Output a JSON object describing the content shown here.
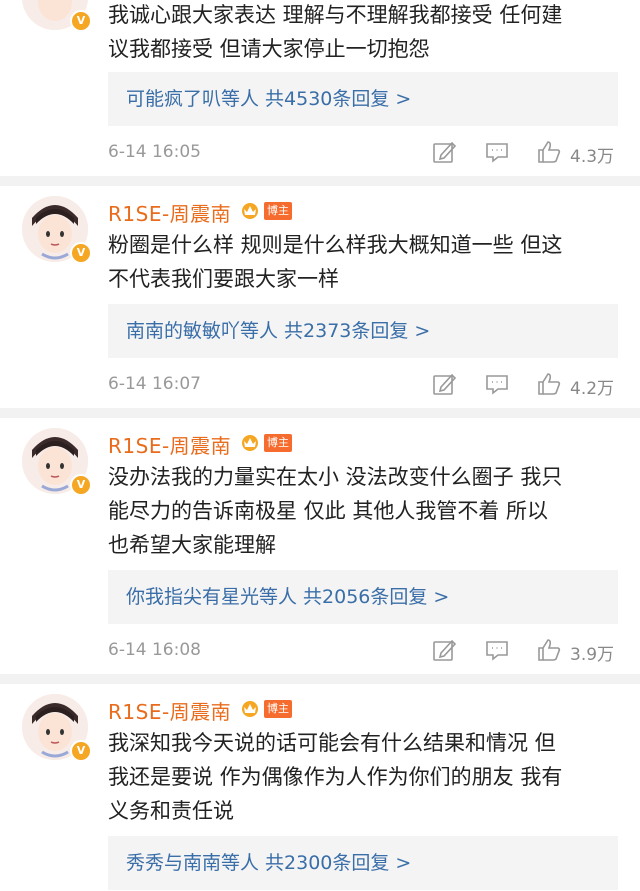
{
  "comments": [
    {
      "show_header": false,
      "text": [
        "我诚心跟大家表达 理解与不理解我都接受 任何建",
        "议我都接受 但请大家停止一切抱怨"
      ],
      "reply_summary": "可能疯了叭等人  共4530条回复 >",
      "time": "6-14 16:05",
      "likes": "4.3万"
    },
    {
      "show_header": true,
      "username": "R1SE-周震南",
      "badge": "博主",
      "text": [
        "粉圈是什么样 规则是什么样我大概知道一些 但这",
        "不代表我们要跟大家一样"
      ],
      "reply_summary": "南南的敏敏吖等人  共2373条回复 >",
      "time": "6-14 16:07",
      "likes": "4.2万"
    },
    {
      "show_header": true,
      "username": "R1SE-周震南",
      "badge": "博主",
      "text": [
        "没办法我的力量实在太小 没法改变什么圈子 我只",
        "能尽力的告诉南极星 仅此 其他人我管不着 所以",
        "也希望大家能理解"
      ],
      "reply_summary": "你我指尖有星光等人  共2056条回复 >",
      "time": "6-14 16:08",
      "likes": "3.9万"
    },
    {
      "show_header": true,
      "username": "R1SE-周震南",
      "badge": "博主",
      "text": [
        "我深知我今天说的话可能会有什么结果和情况 但",
        "我还是要说 作为偶像作为人作为你们的朋友 我有",
        "义务和责任说"
      ],
      "reply_summary": "秀秀与南南等人  共2300条回复 >"
    }
  ],
  "verified_badge": "V",
  "icons": {
    "edit": "edit-icon",
    "comment": "comment-icon",
    "like": "like-icon",
    "crown": "crown-icon"
  },
  "colors": {
    "username": "#e86c1c",
    "tag_bg": "#f56c2e",
    "link": "#3a6ea8",
    "meta": "#999999"
  }
}
